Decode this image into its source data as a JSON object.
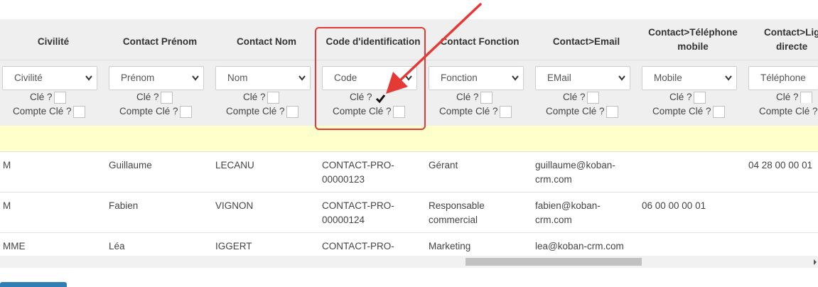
{
  "columns": [
    {
      "title": "Civilité",
      "select": "Civilité",
      "key_label": "Clé ?",
      "key_checked": false,
      "count_label": "Compte Clé ?",
      "count_checked": false
    },
    {
      "title": "Contact Prénom",
      "select": "Prénom",
      "key_label": "Clé ?",
      "key_checked": false,
      "count_label": "Compte Clé ?",
      "count_checked": false
    },
    {
      "title": "Contact Nom",
      "select": "Nom",
      "key_label": "Clé ?",
      "key_checked": false,
      "count_label": "Compte Clé ?",
      "count_checked": false
    },
    {
      "title": "Code d'identification",
      "select": "Code",
      "key_label": "Clé ?",
      "key_checked": true,
      "count_label": "Compte Clé ?",
      "count_checked": false
    },
    {
      "title": "Contact Fonction",
      "select": "Fonction",
      "key_label": "Clé ?",
      "key_checked": false,
      "count_label": "Compte Clé ?",
      "count_checked": false
    },
    {
      "title": "Contact>Email",
      "select": "EMail",
      "key_label": "Clé ?",
      "key_checked": false,
      "count_label": "Compte Clé ?",
      "count_checked": false
    },
    {
      "title_line1": "Contact>Téléphone",
      "title_line2": "mobile",
      "select": "Mobile",
      "key_label": "Clé ?",
      "key_checked": false,
      "count_label": "Compte Clé ?",
      "count_checked": false
    },
    {
      "title_line1": "Contact>Lig",
      "title_line2": "directe",
      "select": "Téléphone",
      "key_label": "Clé ?",
      "key_checked": false,
      "count_label": "Compte Clé ?",
      "count_checked": false
    }
  ],
  "rows": [
    {
      "civilite": "M",
      "prenom": "Guillaume",
      "nom": "LECANU",
      "code_l1": "CONTACT-PRO-",
      "code_l2": "00000123",
      "fonction_l1": "Gérant",
      "fonction_l2": "",
      "email_l1": "guillaume@koban-",
      "email_l2": "crm.com",
      "mobile": "",
      "ligne_directe": "04 28 00 00 01"
    },
    {
      "civilite": "M",
      "prenom": "Fabien",
      "nom": "VIGNON",
      "code_l1": "CONTACT-PRO-",
      "code_l2": "00000124",
      "fonction_l1": "Responsable",
      "fonction_l2": "commercial",
      "email_l1": "fabien@koban-",
      "email_l2": "crm.com",
      "mobile": "06 00 00 00 01",
      "ligne_directe": ""
    },
    {
      "civilite": "MME",
      "prenom": "Léa",
      "nom": "IGGERT",
      "code_l1": "CONTACT-PRO-",
      "code_l2": "",
      "fonction_l1": "Marketing",
      "fonction_l2": "",
      "email_l1": "lea@koban-crm.com",
      "email_l2": "",
      "mobile": "",
      "ligne_directe": ""
    }
  ],
  "colors": {
    "highlight": "#e53935",
    "filter_row": "#ffffcc",
    "header_bg": "#efefef"
  }
}
